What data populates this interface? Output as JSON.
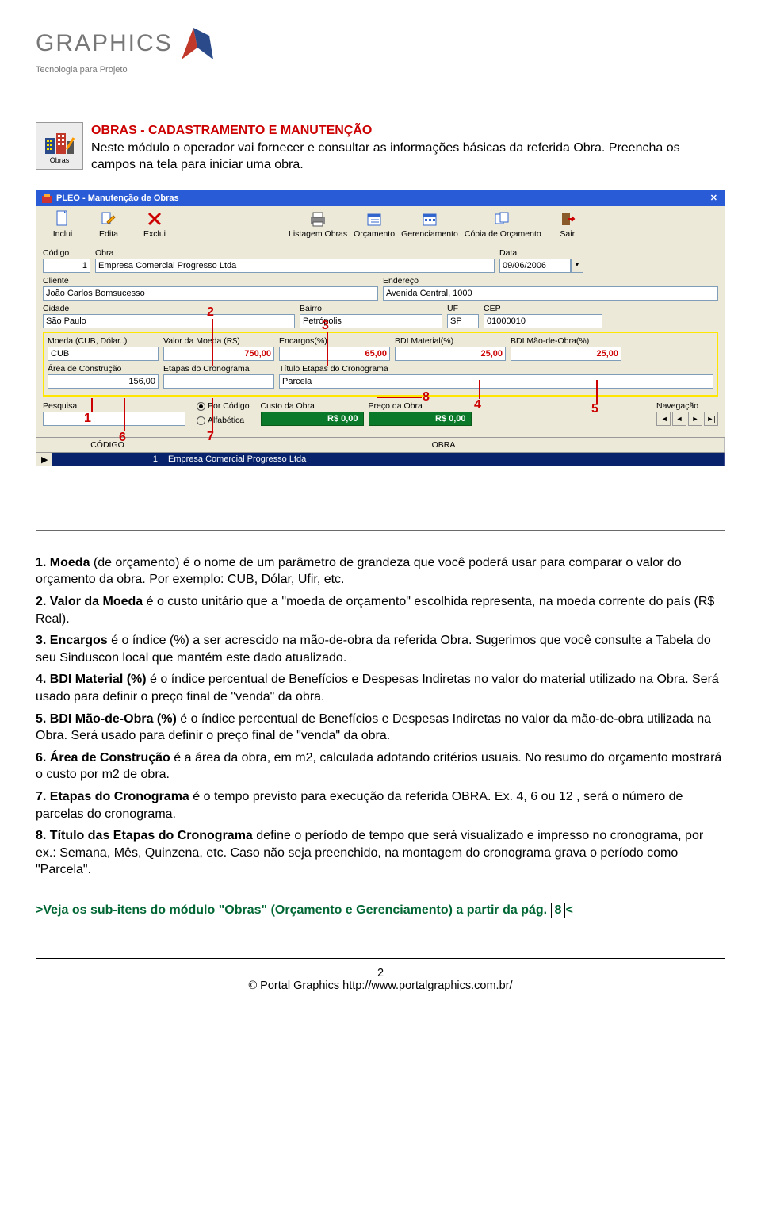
{
  "logo": {
    "name": "GRAPHICS",
    "tagline": "Tecnologia para Projeto"
  },
  "section": {
    "icon_label": "Obras",
    "title": "OBRAS - CADASTRAMENTO E MANUTENÇÃO",
    "intro": "Neste módulo o operador vai fornecer e consultar as informações básicas da referida Obra.  Preencha os campos na tela para iniciar uma obra."
  },
  "app": {
    "title": "PLEO - Manutenção de Obras",
    "toolbar": [
      "Inclui",
      "Edita",
      "Exclui",
      "Listagem Obras",
      "Orçamento",
      "Gerenciamento",
      "Cópia de Orçamento",
      "Sair"
    ],
    "fields": {
      "codigo_label": "Código",
      "codigo": "1",
      "obra_label": "Obra",
      "obra": "Empresa Comercial Progresso Ltda",
      "data_label": "Data",
      "data": "09/06/2006",
      "cliente_label": "Cliente",
      "cliente": "João Carlos Bomsucesso",
      "endereco_label": "Endereço",
      "endereco": "Avenida Central, 1000",
      "cidade_label": "Cidade",
      "cidade": "São Paulo",
      "bairro_label": "Bairro",
      "bairro": "Petrópolis",
      "uf_label": "UF",
      "uf": "SP",
      "cep_label": "CEP",
      "cep": "01000010",
      "moeda_label": "Moeda (CUB, Dólar..)",
      "moeda": "CUB",
      "valor_moeda_label": "Valor da Moeda (R$)",
      "valor_moeda": "750,00",
      "encargos_label": "Encargos(%)",
      "encargos": "65,00",
      "bdi_mat_label": "BDI Material(%)",
      "bdi_mat": "25,00",
      "bdi_mo_label": "BDI Mão-de-Obra(%)",
      "bdi_mo": "25,00",
      "area_label": "Área de Construção",
      "area": "156,00",
      "etapas_label": "Etapas do Cronograma",
      "etapas": "",
      "titulo_etapas_label": "Título Etapas do Cronograma",
      "titulo_etapas": "Parcela",
      "pesquisa_label": "Pesquisa",
      "radio1": "Por Código",
      "radio2": "Alfabética",
      "custo_label": "Custo da Obra",
      "custo": "R$ 0,00",
      "preco_label": "Preço da Obra",
      "preco": "R$ 0,00",
      "nav_label": "Navegação"
    },
    "grid": {
      "h1": "CÓDIGO",
      "h2": "OBRA",
      "r_codigo": "1",
      "r_obra": "Empresa Comercial Progresso Ltda"
    },
    "ann": {
      "1": "1",
      "2": "2",
      "3": "3",
      "4": "4",
      "5": "5",
      "6": "6",
      "7": "7",
      "8": "8"
    }
  },
  "desc": {
    "d1_a": "1. Moeda",
    "d1_b": " (de orçamento) é o nome de um parâmetro de grandeza que você poderá usar para comparar o valor do orçamento da obra.  Por exemplo: CUB, Dólar, Ufir, etc.",
    "d2_a": "2. Valor da Moeda",
    "d2_b": " é o custo unitário que a \"moeda de orçamento\" escolhida representa, na moeda corrente do país (R$ Real).",
    "d3_a": "3. Encargos",
    "d3_b": " é o índice (%) a ser acrescido na mão-de-obra da referida Obra.  Sugerimos que você consulte a Tabela do seu Sinduscon local que mantém este dado atualizado.",
    "d4_a": "4. BDI Material (%)",
    "d4_b": " é o índice percentual de Benefícios e Despesas Indiretas no valor do material utilizado na Obra.  Será usado para definir o preço final de \"venda\" da obra.",
    "d5_a": "5. BDI Mão-de-Obra (%)",
    "d5_b": " é o índice percentual de Benefícios e Despesas Indiretas no valor da mão-de-obra utilizada na Obra.  Será usado para definir o preço final de \"venda\" da obra.",
    "d6_a": "6. Área de Construção",
    "d6_b": " é a área da obra, em m2, calculada adotando critérios usuais.  No resumo do orçamento mostrará o custo por m2 de obra.",
    "d7_a": "7. Etapas do Cronograma",
    "d7_b": " é o tempo previsto para execução da referida OBRA.  Ex. 4, 6 ou 12 , será o número de parcelas do cronograma.",
    "d8_a": "8. Título das Etapas do Cronograma",
    "d8_b": " define o período de tempo que será visualizado e impresso no cronograma, por ex.: Semana, Mês, Quinzena, etc.  Caso não seja preenchido, na montagem do cronograma grava o período como \"Parcela\"."
  },
  "sublink_a": ">Veja os sub-itens do módulo \"Obras\" (Orçamento e Gerenciamento) a partir da pág. ",
  "sublink_num": "8",
  "sublink_b": "<",
  "footer": {
    "page": "2",
    "copyright": "© Portal Graphics http://www.portalgraphics.com.br/"
  }
}
